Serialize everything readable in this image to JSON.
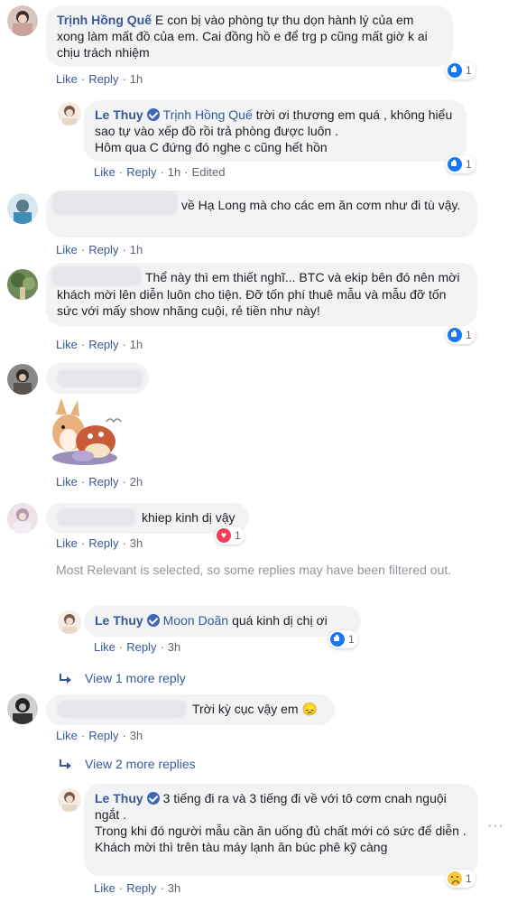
{
  "comments": {
    "c1": {
      "author": "Trịnh Hồng Quế",
      "text": "E con bị vào phòng tự thu dọn hành lý của em xong làm mất đồ của em. Cai đồng hồ e để trg p cũng mất giờ k ai chịu trách nhiệm",
      "like": "Like",
      "reply": "Reply",
      "time": "1h",
      "reactions": "1"
    },
    "r1": {
      "author": "Le Thuy",
      "tagged": "Trịnh Hồng Quế",
      "line1": "trời ơi thương em quá , không hiểu sao tự vào xếp đồ rồi trả phòng được luôn .",
      "line2": "Hôm qua C đứng đó nghe c cũng hết hồn",
      "like": "Like",
      "reply": "Reply",
      "time": "1h",
      "edited": "Edited",
      "reactions": "1"
    },
    "c2": {
      "text": "về Hạ Long mà cho các em ăn cơm như đi tù vậy.",
      "like": "Like",
      "reply": "Reply",
      "time": "1h"
    },
    "c3": {
      "text": "Thể này thì em thiết nghĩ... BTC và ekip bên đó nên mời khách mời lên diễn luôn cho tiện. Đỡ tốn phí thuê mẫu và mẫu đỡ tốn sức với mấy show nhăng cuội, rẻ tiền như này!",
      "like": "Like",
      "reply": "Reply",
      "time": "1h",
      "reactions": "1"
    },
    "c4": {
      "like": "Like",
      "reply": "Reply",
      "time": "2h"
    },
    "c5": {
      "text": "khiep kinh dị vậy",
      "like": "Like",
      "reply": "Reply",
      "time": "3h",
      "reactions": "1"
    },
    "filter_note": "Most Relevant is selected, so some replies may have been filtered out.",
    "r2": {
      "author": "Le Thuy",
      "tagged": "Moon Doãn",
      "text": "quá kinh dị chị ơi",
      "like": "Like",
      "reply": "Reply",
      "time": "3h",
      "reactions": "1"
    },
    "view_more_1": "View 1 more reply",
    "c6": {
      "text": "Trời kỳ cục vậy em 😞",
      "like": "Like",
      "reply": "Reply",
      "time": "3h"
    },
    "view_more_2": "View 2 more replies",
    "r3": {
      "author": "Le Thuy",
      "line1": "3 tiếng đi ra và 3 tiếng đi về với tô cơm cnah nguội ngắt .",
      "line2": "Trong khi đó người mẫu cần ăn uống đủ chất mới có sức để diễn .",
      "line3": "Khách mời thì trên tàu máy lạnh ăn búc phê kỹ càng",
      "like": "Like",
      "reply": "Reply",
      "time": "3h",
      "reactions": "1"
    }
  },
  "colors": {
    "link": "#385898",
    "bubble": "#f2f3f5",
    "meta": "#606770",
    "like_blue": "#1877f2",
    "heart": "#f33e58"
  }
}
